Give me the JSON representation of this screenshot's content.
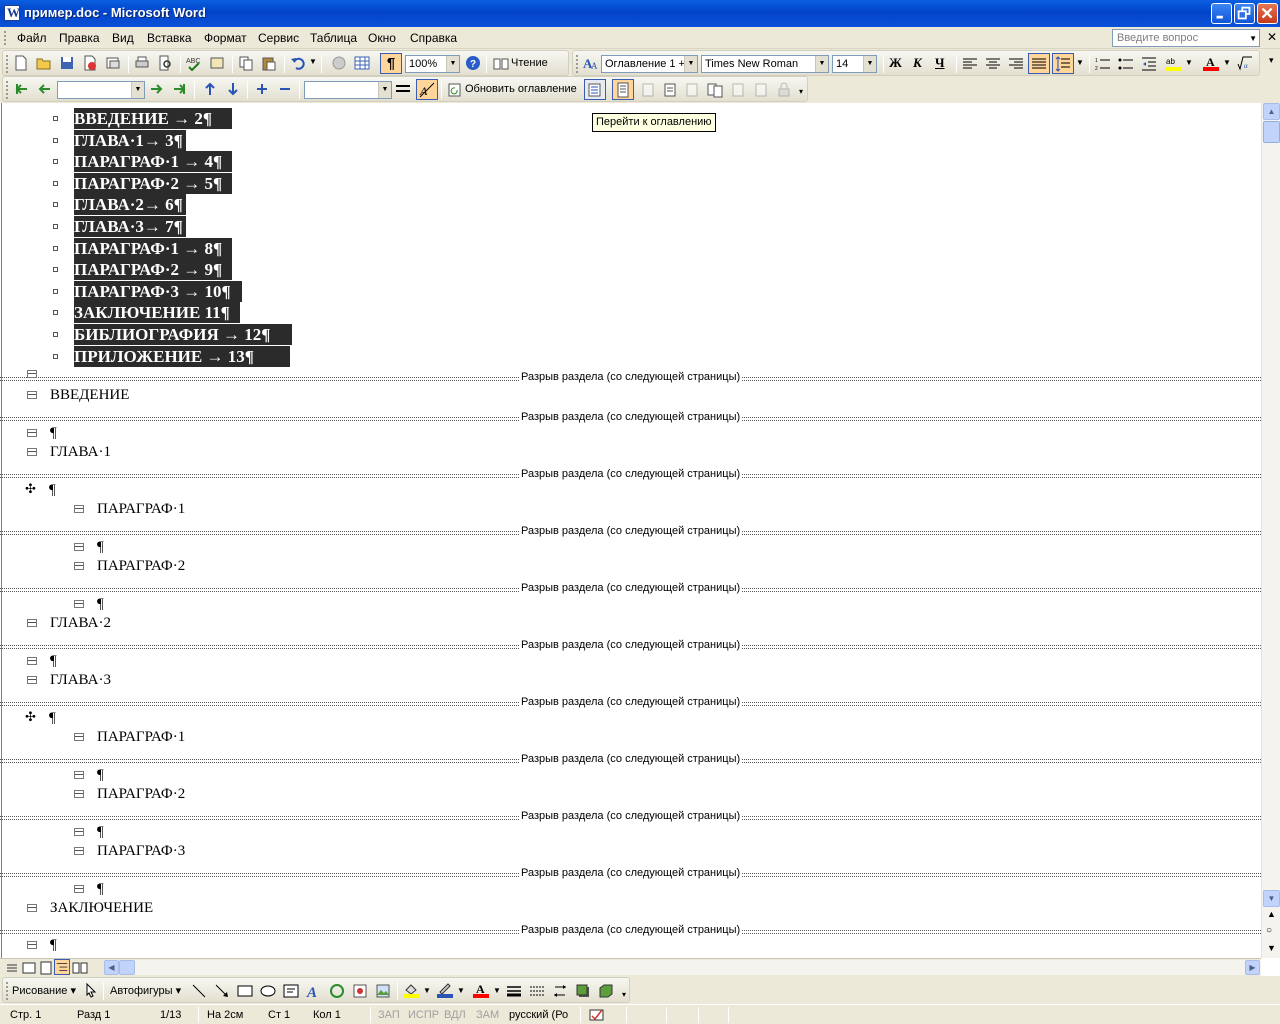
{
  "window": {
    "title": "пример.doc - Microsoft Word"
  },
  "menu": [
    "Файл",
    "Правка",
    "Вид",
    "Вставка",
    "Формат",
    "Сервис",
    "Таблица",
    "Окно",
    "Справка"
  ],
  "help": {
    "placeholder": "Введите вопрос"
  },
  "toolbar": {
    "zoom": "100%",
    "reading_label": "Чтение",
    "style": "Оглавление 1 +",
    "font": "Times New Roman",
    "size": "14",
    "bold": "Ж",
    "italic": "К",
    "underline": "Ч"
  },
  "outline": {
    "update_toc_label": "Обновить оглавление"
  },
  "tooltip": "Перейти к оглавлению",
  "toc": [
    {
      "text": "ВВЕДЕНИЕ  →  2¶"
    },
    {
      "text": "ГЛАВА·1→ 3¶"
    },
    {
      "text": "ПАРАГРАФ·1  →  4¶"
    },
    {
      "text": "ПАРАГРАФ·2  →  5¶"
    },
    {
      "text": "ГЛАВА·2→ 6¶"
    },
    {
      "text": "ГЛАВА·3→ 7¶"
    },
    {
      "text": "ПАРАГРАФ·1  →  8¶"
    },
    {
      "text": "ПАРАГРАФ·2  →  9¶"
    },
    {
      "text": "ПАРАГРАФ·3  →  10¶"
    },
    {
      "text": "ЗАКЛЮЧЕНИЕ 11¶"
    },
    {
      "text": "БИБЛИОГРАФИЯ →  12¶"
    },
    {
      "text": "ПРИЛОЖЕНИЕ    →    13¶"
    }
  ],
  "section_break_label": "Разрыв раздела (со следующей страницы)",
  "pilcrow": "¶",
  "body": {
    "intro": "ВВЕДЕНИЕ",
    "ch1": "ГЛАВА·1",
    "p1": "ПАРАГРАФ·1",
    "p2": "ПАРАГРАФ·2",
    "ch2": "ГЛАВА·2",
    "ch3": "ГЛАВА·3",
    "p31": "ПАРАГРАФ·1",
    "p32": "ПАРАГРАФ·2",
    "p33": "ПАРАГРАФ·3",
    "concl": "ЗАКЛЮЧЕНИЕ"
  },
  "drawing": {
    "draw_label": "Рисование ▾",
    "shapes_label": "Автофигуры ▾"
  },
  "status": {
    "page": "Стр.  1",
    "section": "Разд  1",
    "count": "1/13",
    "at": "На  2см",
    "line": "Ст  1",
    "col": "Кол  1",
    "rec": "ЗАП",
    "trk": "ИСПР",
    "ext": "ВДЛ",
    "ovr": "ЗАМ",
    "lang": "русский (Ро"
  }
}
